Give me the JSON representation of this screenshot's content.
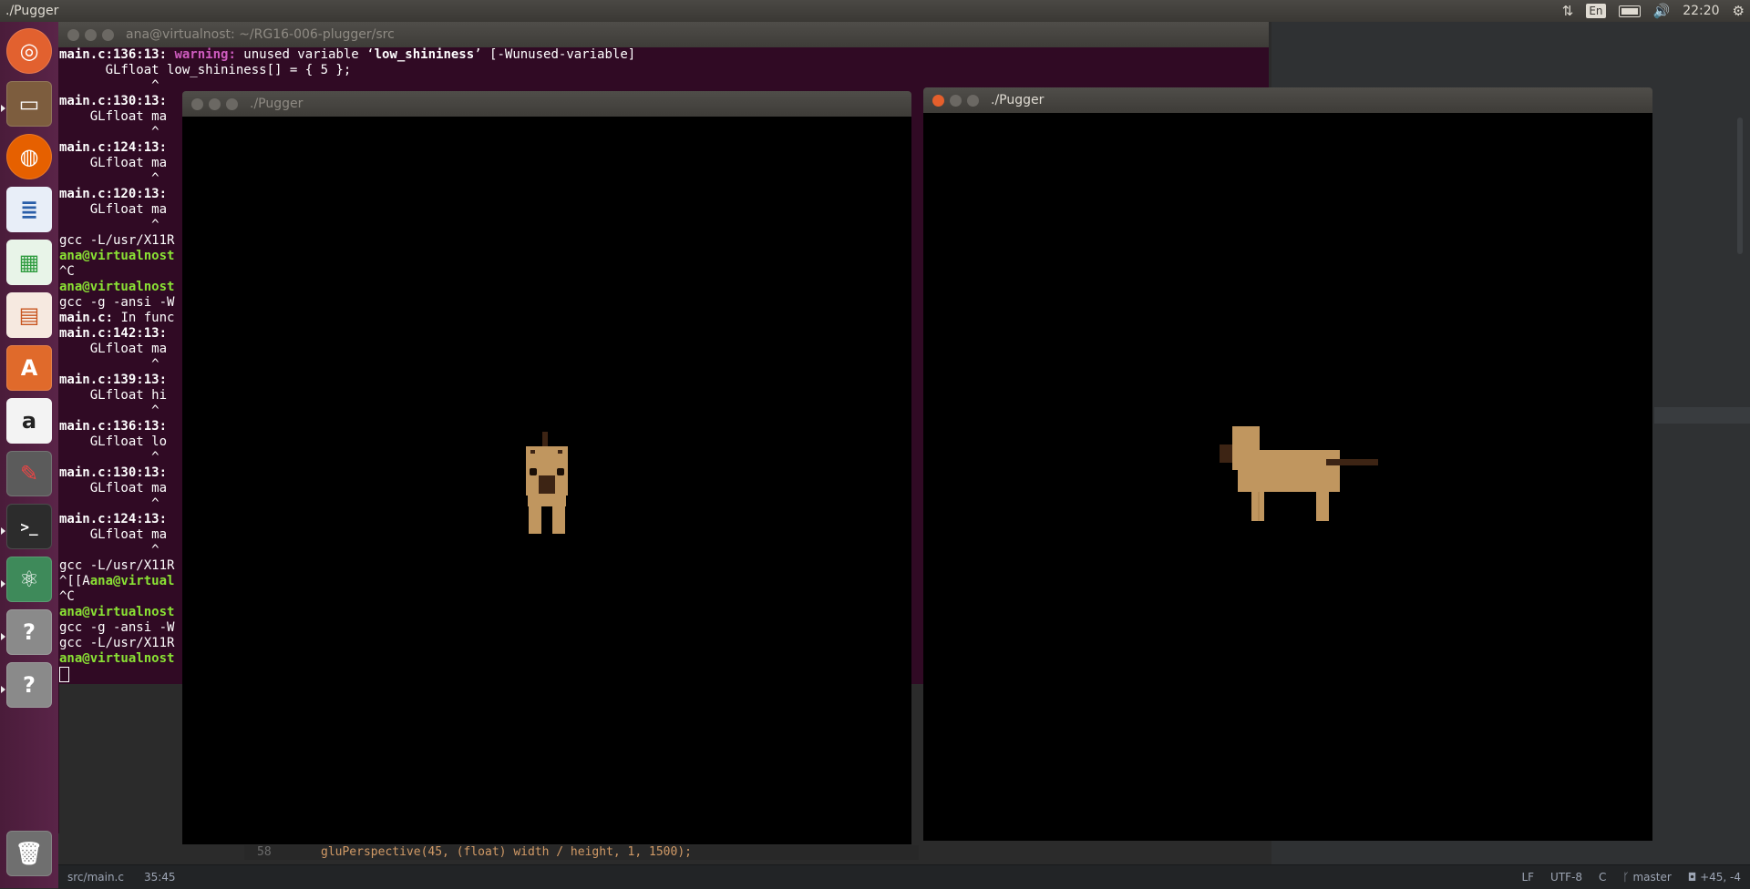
{
  "topbar": {
    "app_title": "./Pugger",
    "lang": "En",
    "clock": "22:20"
  },
  "launcher": {
    "items": [
      {
        "icon": "dash-icon",
        "color": "#e9663a"
      },
      {
        "icon": "files-icon",
        "color": "#8b6a4a"
      },
      {
        "icon": "firefox-icon",
        "color": "#e66000"
      },
      {
        "icon": "writer-icon",
        "color": "#2a5ea8"
      },
      {
        "icon": "calc-icon",
        "color": "#2e9b3e"
      },
      {
        "icon": "impress-icon",
        "color": "#c8551f"
      },
      {
        "icon": "software-center-icon",
        "color": "#e06a2b"
      },
      {
        "icon": "amazon-icon",
        "color": "#f3f3f3"
      },
      {
        "icon": "system-settings-icon",
        "color": "#a0302e"
      },
      {
        "icon": "terminal-icon",
        "color": "#2c2c2c"
      },
      {
        "icon": "atom-icon",
        "color": "#3e8a5a"
      },
      {
        "icon": "unknown-app-icon",
        "color": "#8a8a8a"
      },
      {
        "icon": "unknown-app-icon",
        "color": "#8a8a8a"
      },
      {
        "icon": "trash-icon",
        "color": "#9a9a9a"
      }
    ]
  },
  "terminal": {
    "title": "ana@virtualnost: ~/RG16-006-plugger/src",
    "lines": [
      {
        "a": "main.c:136:13: ",
        "b": "warning: ",
        "c": "unused variable ‘",
        "d": "low_shininess",
        "e": "’ [-Wunused-variable]"
      },
      {
        "a": "",
        "c": "      GLfloat low_shininess[] = { 5 };"
      },
      {
        "c": "            ^"
      },
      {
        "a": "main.c:130:13:",
        "c": ""
      },
      {
        "c": "    GLfloat ma"
      },
      {
        "c": "            ^"
      },
      {
        "a": "main.c:124:13:",
        "c": ""
      },
      {
        "c": "    GLfloat ma"
      },
      {
        "c": "            ^"
      },
      {
        "a": "main.c:120:13:",
        "c": ""
      },
      {
        "c": "    GLfloat ma"
      },
      {
        "c": "            ^"
      },
      {
        "c": "gcc -L/usr/X11R"
      },
      {
        "g": "ana@virtualnost"
      },
      {
        "c": "^C"
      },
      {
        "g": "ana@virtualnost"
      },
      {
        "c": "gcc -g -ansi -W"
      },
      {
        "a": "main.c:",
        "c": " In func"
      },
      {
        "a": "main.c:142:13:",
        "c": ""
      },
      {
        "c": "    GLfloat ma"
      },
      {
        "c": "            ^"
      },
      {
        "a": "main.c:139:13:",
        "c": ""
      },
      {
        "c": "    GLfloat hi"
      },
      {
        "c": "            ^"
      },
      {
        "a": "main.c:136:13:",
        "c": ""
      },
      {
        "c": "    GLfloat lo"
      },
      {
        "c": "            ^"
      },
      {
        "a": "main.c:130:13:",
        "c": ""
      },
      {
        "c": "    GLfloat ma"
      },
      {
        "c": "            ^"
      },
      {
        "a": "main.c:124:13:",
        "c": ""
      },
      {
        "c": "    GLfloat ma"
      },
      {
        "c": "            ^"
      },
      {
        "c": "gcc -L/usr/X11R"
      },
      {
        "c": "^[[A",
        "g": "ana@virtual"
      },
      {
        "c": "^C"
      },
      {
        "g": "ana@virtualnost"
      },
      {
        "c": "gcc -g -ansi -W"
      },
      {
        "c": "gcc -L/usr/X11R"
      },
      {
        "g": "ana@virtualnost"
      }
    ]
  },
  "pugger_left": {
    "title": "./Pugger"
  },
  "pugger_right": {
    "title": "./Pugger"
  },
  "editor": {
    "line_number": "58",
    "code": "gluPerspective(45, (float) width / height, 1, 1500);"
  },
  "statusbar": {
    "file": "src/main.c",
    "cursor": "35:45",
    "line_ending": "LF",
    "encoding": "UTF-8",
    "grammar": "C",
    "branch": "master",
    "diff": "+45, -4"
  },
  "colors": {
    "terminal_bg": "#300a24",
    "pug_body": "#c0965f",
    "pug_dark": "#3d2414"
  }
}
